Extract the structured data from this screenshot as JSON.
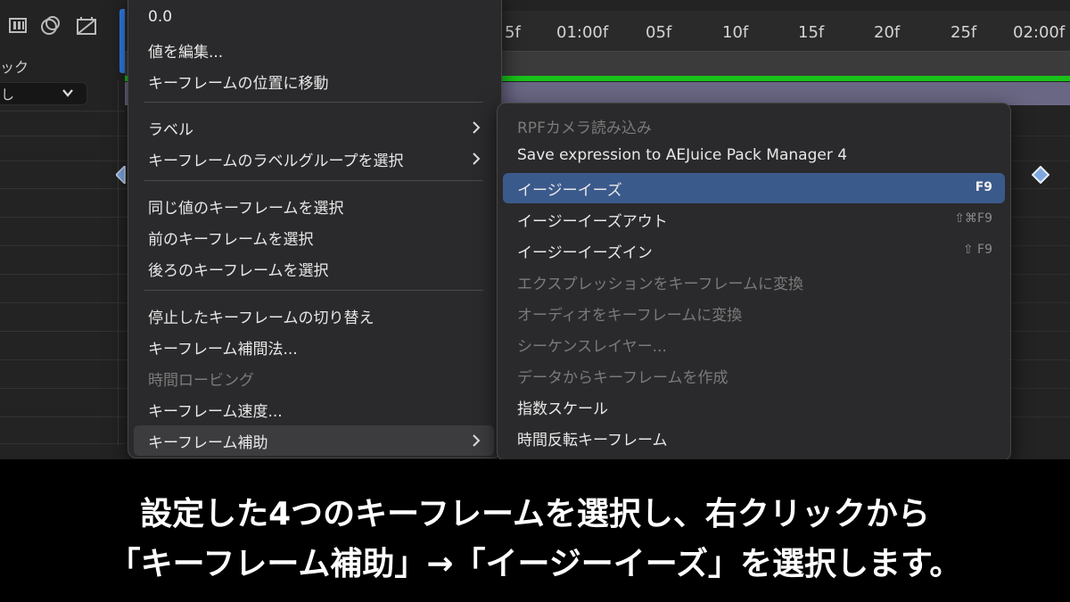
{
  "left_panel": {
    "label": "ック",
    "dropdown_value": "し"
  },
  "timeline": {
    "ruler_ticks": [
      "5f",
      "01:00f",
      "05f",
      "10f",
      "15f",
      "20f",
      "25f",
      "02:00f"
    ]
  },
  "context_menu": {
    "items": [
      {
        "label": "0.0"
      },
      {
        "label": "値を編集..."
      },
      {
        "label": "キーフレームの位置に移動"
      },
      {
        "label": "ラベル"
      },
      {
        "label": "キーフレームのラベルグループを選択"
      },
      {
        "label": "同じ値のキーフレームを選択"
      },
      {
        "label": "前のキーフレームを選択"
      },
      {
        "label": "後ろのキーフレームを選択"
      },
      {
        "label": "停止したキーフレームの切り替え"
      },
      {
        "label": "キーフレーム補間法..."
      },
      {
        "label": "時間ロービング"
      },
      {
        "label": "キーフレーム速度..."
      },
      {
        "label": "キーフレーム補助"
      }
    ]
  },
  "submenu": {
    "items": [
      {
        "label": "RPFカメラ読み込み",
        "shortcut": ""
      },
      {
        "label": "Save expression to AEJuice Pack Manager 4",
        "shortcut": ""
      },
      {
        "label": "イージーイーズ",
        "shortcut": "F9"
      },
      {
        "label": "イージーイーズアウト",
        "shortcut": "⇧⌘F9"
      },
      {
        "label": "イージーイーズイン",
        "shortcut": "⇧ F9"
      },
      {
        "label": "エクスプレッションをキーフレームに変換",
        "shortcut": ""
      },
      {
        "label": "オーディオをキーフレームに変換",
        "shortcut": ""
      },
      {
        "label": "シーケンスレイヤー...",
        "shortcut": ""
      },
      {
        "label": "データからキーフレームを作成",
        "shortcut": ""
      },
      {
        "label": "指数スケール",
        "shortcut": ""
      },
      {
        "label": "時間反転キーフレーム",
        "shortcut": ""
      }
    ]
  },
  "caption": {
    "line1": "設定した4つのキーフレームを選択し、右クリックから",
    "line2": "「キーフレーム補助」→「イージーイーズ」を選択します。"
  },
  "colors": {
    "selected_item": "#3b5a8c",
    "work_area_green": "#19c21a",
    "layer_bar": "#6a6784",
    "keyframe_fill": "#7fa8e0"
  },
  "icons": [
    "layers-icon",
    "mask-icon",
    "composition-icon",
    "chevron-down-icon",
    "submenu-arrow-icon",
    "keyframe-diamond-icon"
  ]
}
